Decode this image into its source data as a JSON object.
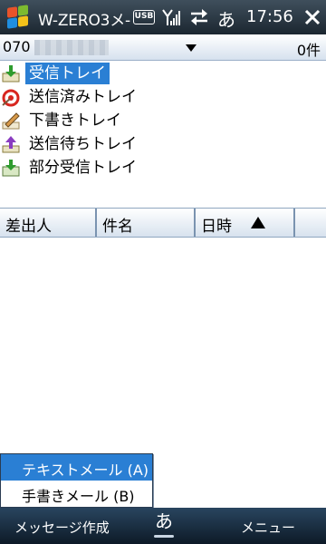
{
  "titlebar": {
    "title": "W-ZERO3メ-",
    "usb_label": "USB",
    "ime_label": "あ",
    "time": "17:56"
  },
  "account": {
    "name": "070",
    "count": "0件"
  },
  "folders": [
    {
      "label": "受信トレイ",
      "icon": "inbox-icon",
      "selected": true
    },
    {
      "label": "送信済みトレイ",
      "icon": "sent-icon",
      "selected": false
    },
    {
      "label": "下書きトレイ",
      "icon": "drafts-icon",
      "selected": false
    },
    {
      "label": "送信待ちトレイ",
      "icon": "outbox-icon",
      "selected": false
    },
    {
      "label": "部分受信トレイ",
      "icon": "partial-inbox-icon",
      "selected": false
    }
  ],
  "columns": {
    "from": "差出人",
    "subject": "件名",
    "date": "日時"
  },
  "popup_menu": {
    "items": [
      {
        "label": "テキストメール (A)",
        "selected": true
      },
      {
        "label": "手書きメール (B)",
        "selected": false
      }
    ]
  },
  "softkeys": {
    "left": "メッセージ作成",
    "ime": "あ",
    "right": "メニュー"
  },
  "colors": {
    "selection": "#2a7fd4",
    "titlebar": "#2a3642",
    "header_gradient_end": "#d7e2ee"
  }
}
